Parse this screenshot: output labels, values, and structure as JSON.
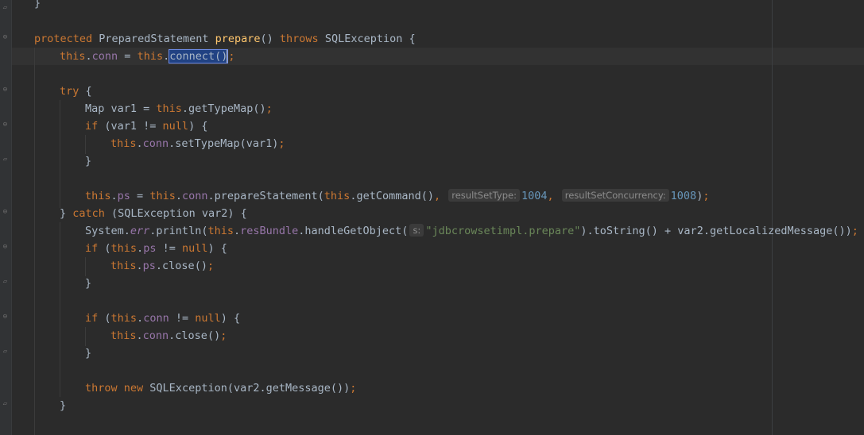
{
  "code": {
    "l0": "}",
    "l1": {
      "kw1": "protected",
      "type": "PreparedStatement",
      "fn": "prepare",
      "paren": "()",
      "kw2": "throws",
      "exc": "SQLException {"
    },
    "l2": {
      "this1": "this",
      "dot1": ".",
      "conn": "conn",
      "eq": " = ",
      "this2": "this",
      "dot2": ".",
      "sel": "connect()",
      "semi": ";"
    },
    "l3": {
      "kw": "try",
      "rest": " {"
    },
    "l4": {
      "a": "Map var1 = ",
      "this": "this",
      "b": ".getTypeMap()",
      "semi": ";"
    },
    "l5": {
      "kw": "if",
      "a": " (var1 != ",
      "null": "null",
      "b": ") {"
    },
    "l6": {
      "this": "this",
      "dot": ".",
      "conn": "conn",
      "b": ".setTypeMap(var1)",
      "semi": ";"
    },
    "l7": "}",
    "l8": {
      "this1": "this",
      "dot1": ".",
      "ps": "ps",
      "eq": " = ",
      "this2": "this",
      "dot2": ".",
      "conn": "conn",
      "m": ".prepareStatement(",
      "this3": "this",
      "g": ".getCommand()",
      "c1": ", ",
      "h1": "resultSetType:",
      "n1": "1004",
      "c2": ", ",
      "h2": "resultSetConcurrency:",
      "n2": "1008",
      "end": ")",
      "semi": ";"
    },
    "l9": {
      "a": "} ",
      "kw": "catch",
      "b": " (SQLException var2) {"
    },
    "l10": {
      "sys": "System.",
      "err": "err",
      "p": ".println(",
      "this": "this",
      "dot": ".",
      "rb": "resBundle",
      "h": ".handleGetObject(",
      "hint": "s:",
      "str": "\"jdbcrowsetimpl.prepare\"",
      "rest": ").toString() + var2.getLocalizedMessage())",
      "semi": ";"
    },
    "l11": {
      "kw": "if",
      "a": " (",
      "this": "this",
      "dot": ".",
      "ps": "ps",
      "b": " != ",
      "null": "null",
      "c": ") {"
    },
    "l12": {
      "this": "this",
      "dot": ".",
      "ps": "ps",
      "b": ".close()",
      "semi": ";"
    },
    "l13": "}",
    "l14": {
      "kw": "if",
      "a": " (",
      "this": "this",
      "dot": ".",
      "conn": "conn",
      "b": " != ",
      "null": "null",
      "c": ") {"
    },
    "l15": {
      "this": "this",
      "dot": ".",
      "conn": "conn",
      "b": ".close()",
      "semi": ";"
    },
    "l16": "}",
    "l17": {
      "kw1": "throw",
      "sp": " ",
      "kw2": "new",
      "rest": " SQLException(var2.getMessage())",
      "semi": ";"
    },
    "l18": "}"
  }
}
